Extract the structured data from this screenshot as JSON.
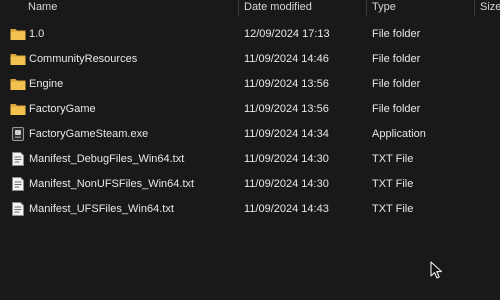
{
  "columns": {
    "name": "Name",
    "date_modified": "Date modified",
    "type": "Type",
    "size": "Size"
  },
  "files": [
    {
      "name": "1.0",
      "date": "12/09/2024 17:13",
      "type": "File folder",
      "icon": "folder-icon"
    },
    {
      "name": "CommunityResources",
      "date": "11/09/2024 14:46",
      "type": "File folder",
      "icon": "folder-icon"
    },
    {
      "name": "Engine",
      "date": "11/09/2024 13:56",
      "type": "File folder",
      "icon": "folder-icon"
    },
    {
      "name": "FactoryGame",
      "date": "11/09/2024 13:56",
      "type": "File folder",
      "icon": "folder-icon"
    },
    {
      "name": "FactoryGameSteam.exe",
      "date": "11/09/2024 14:34",
      "type": "Application",
      "icon": "application-icon"
    },
    {
      "name": "Manifest_DebugFiles_Win64.txt",
      "date": "11/09/2024 14:30",
      "type": "TXT File",
      "icon": "text-file-icon"
    },
    {
      "name": "Manifest_NonUFSFiles_Win64.txt",
      "date": "11/09/2024 14:30",
      "type": "TXT File",
      "icon": "text-file-icon"
    },
    {
      "name": "Manifest_UFSFiles_Win64.txt",
      "date": "11/09/2024 14:43",
      "type": "TXT File",
      "icon": "text-file-icon"
    }
  ],
  "colors": {
    "background": "#191919",
    "text": "#e8e8e8",
    "folder": "#f2c14e"
  }
}
